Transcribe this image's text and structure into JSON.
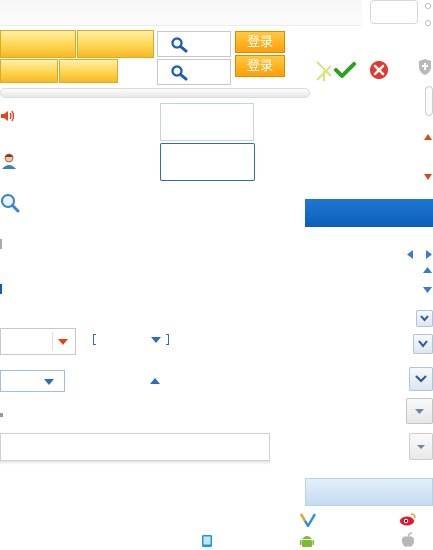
{
  "header": {
    "login_label_1": "登录",
    "login_label_2": "登录"
  },
  "icons": {
    "search": "search-icon",
    "speaker": "speaker-icon",
    "user": "user-icon",
    "magnifier": "magnifier-icon",
    "check": "check-icon",
    "close": "close-icon",
    "shield": "shield-icon",
    "weibo": "weibo-icon",
    "android": "android-icon",
    "apple": "apple-icon",
    "tablet": "tablet-icon"
  },
  "colors": {
    "accent_blue": "#0c5fb8",
    "login_orange": "#ff9f0a",
    "tab_yellow": "#ffd24a",
    "arrow_red": "#e0461b",
    "check_green": "#2aa21f",
    "close_red": "#e5352c"
  }
}
